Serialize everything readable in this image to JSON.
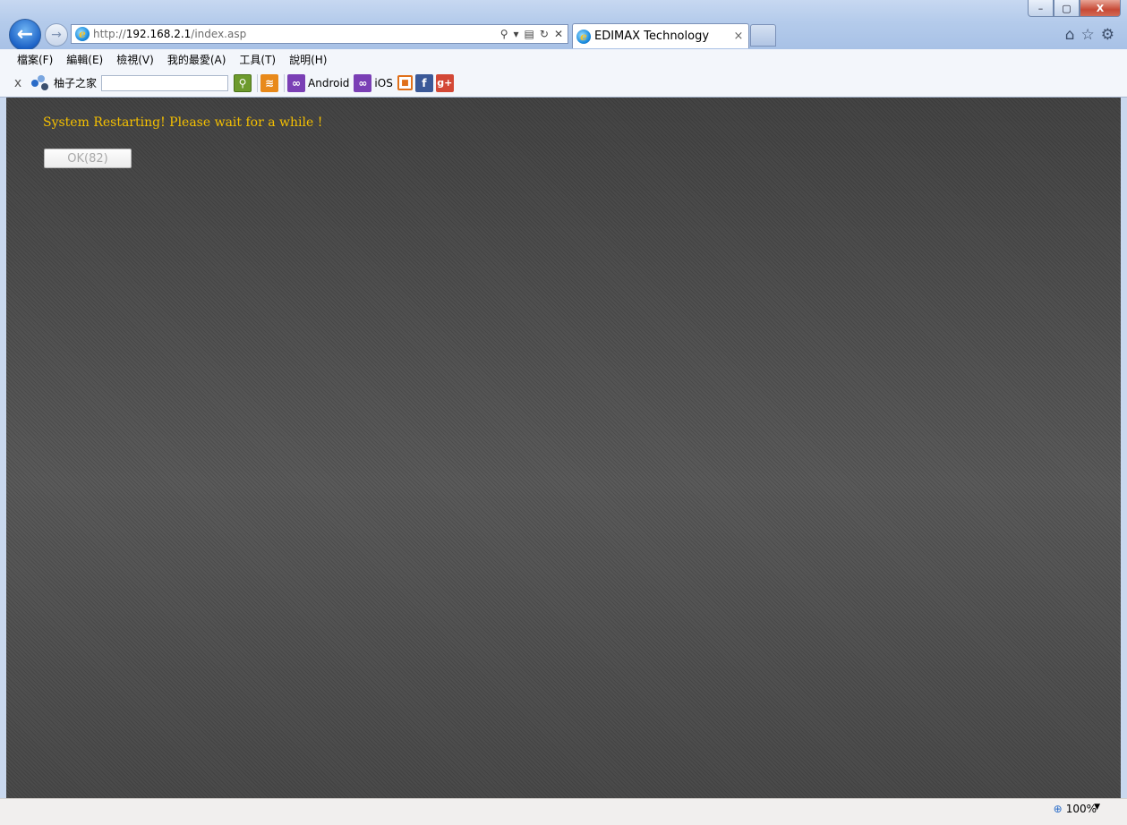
{
  "window": {
    "controls": {
      "minimize": "–",
      "restore": "▢",
      "close": "X"
    }
  },
  "address": {
    "url_prefix": "http://",
    "url_host": "192.168.2.1",
    "url_path": "/index.asp"
  },
  "tab": {
    "title": "EDIMAX Technology",
    "close": "×"
  },
  "menu": {
    "items": [
      "檔案(F)",
      "編輯(E)",
      "檢視(V)",
      "我的最愛(A)",
      "工具(T)",
      "說明(H)"
    ]
  },
  "toolbar": {
    "close": "x",
    "site_label": "柚子之家",
    "search_value": "",
    "android_label": "Android",
    "ios_label": "iOS"
  },
  "page": {
    "message": "System Restarting! Please wait for a while !",
    "ok_button": "OK(82)"
  },
  "status": {
    "zoom": "100%"
  },
  "colors": {
    "message": "#f5c000",
    "background": "#555555",
    "chrome": "#c7d8f1"
  }
}
